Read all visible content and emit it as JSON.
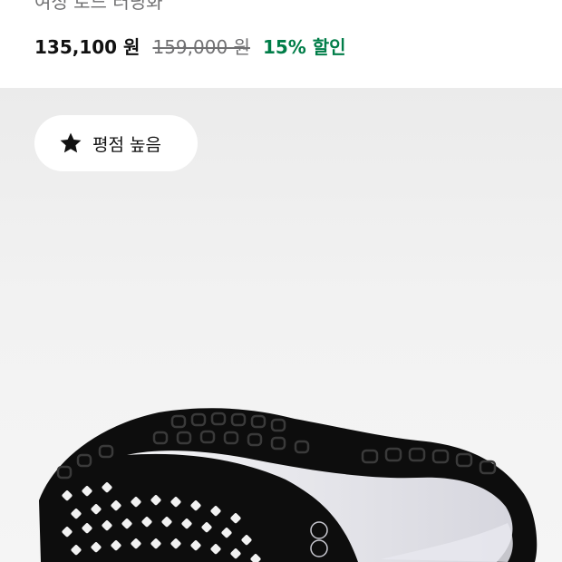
{
  "product": {
    "subtitle_partial": "여성 로드 러닝화",
    "price_current": "135,100 원",
    "price_original": "159,000 원",
    "discount": "15% 할인"
  },
  "media": {
    "badge_label": "평점 높음",
    "badge_icon": "star-icon",
    "image_alt": "shoe-outsole-image"
  },
  "colors": {
    "discount": "#007d48",
    "price_strike": "#707072",
    "text": "#111111"
  }
}
